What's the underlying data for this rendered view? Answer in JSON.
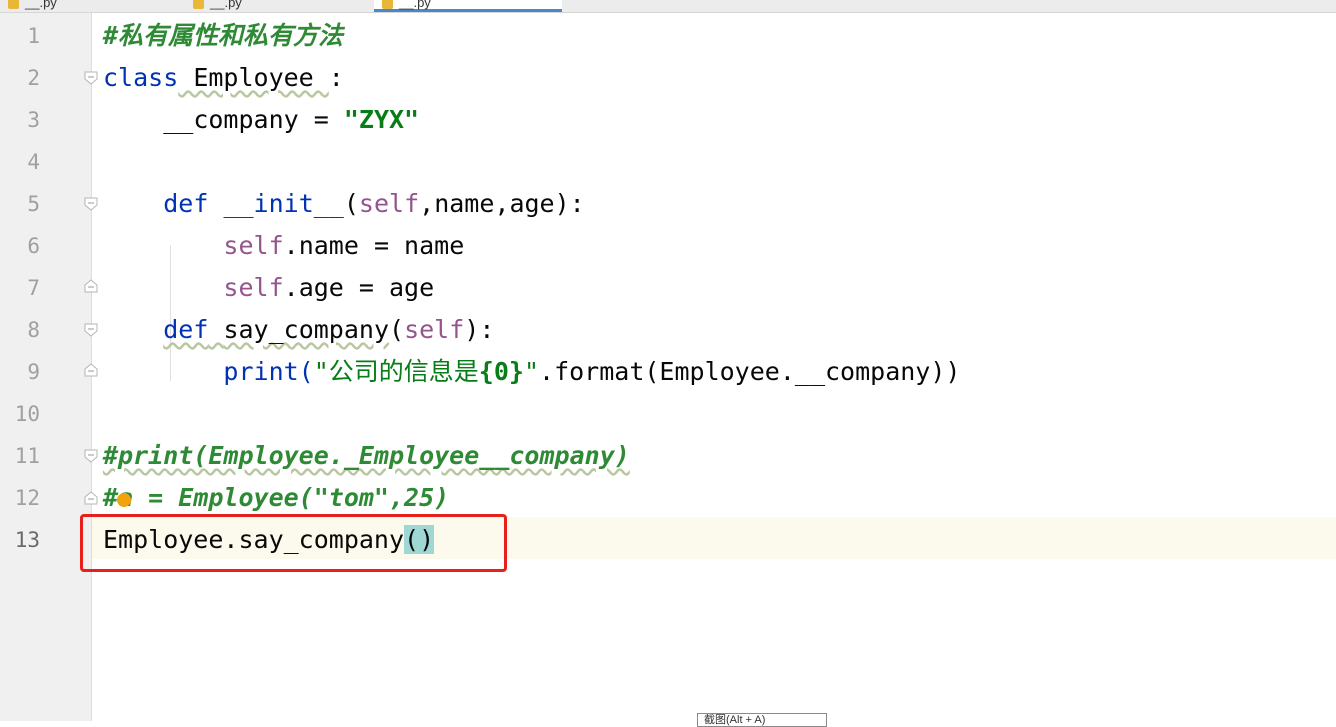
{
  "tabs": [
    {
      "label": "__.py"
    },
    {
      "label": "__.py"
    },
    {
      "label": "__.py"
    }
  ],
  "gutter": {
    "line_numbers": [
      "1",
      "2",
      "3",
      "4",
      "5",
      "6",
      "7",
      "8",
      "9",
      "10",
      "11",
      "12",
      "13"
    ],
    "current_line": "13"
  },
  "code": {
    "l1_comment": "#私有属性和私有方法",
    "l2_kw": "class",
    "l2_name": " Employee ",
    "l2_colon": ":",
    "l3_indent": "    ",
    "l3_name": "__company",
    "l3_eq": " = ",
    "l3_str": "\"ZYX\"",
    "l5_indent": "    ",
    "l5_kw": "def",
    "l5_sp": " ",
    "l5_fn": "__init__",
    "l5_open": "(",
    "l5_self": "self",
    "l5_rest": ",name,age):",
    "l6_indent": "        ",
    "l6_self": "self",
    "l6_rest": ".name = name",
    "l7_indent": "        ",
    "l7_self": "self",
    "l7_rest": ".age = age",
    "l8_indent": "    ",
    "l8_kw": "def",
    "l8_sp": " ",
    "l8_fn": "say_company",
    "l8_open": "(",
    "l8_self": "self",
    "l8_rest": "):",
    "l9_indent": "        ",
    "l9_fn": "print(",
    "l9_str1": "\"公司的信息是",
    "l9_str2": "{0}",
    "l9_str3": "\"",
    "l9_rest": ".format(Employee.__company))",
    "l11_comment": "#print(Employee._Employee__company)",
    "l12_comment": "#a = Employee(\"tom\",25)",
    "l13_code": "Employee.say_company",
    "l13_open": "(",
    "l13_close": ")"
  },
  "status": {
    "bottom_widget": "截图(Alt + A)"
  },
  "colors": {
    "keyword": "#0033b3",
    "self": "#94558d",
    "string": "#067d17",
    "comment": "#2f8a36",
    "highlight_box": "#e8201c",
    "paren_match": "#9ed7d3"
  }
}
